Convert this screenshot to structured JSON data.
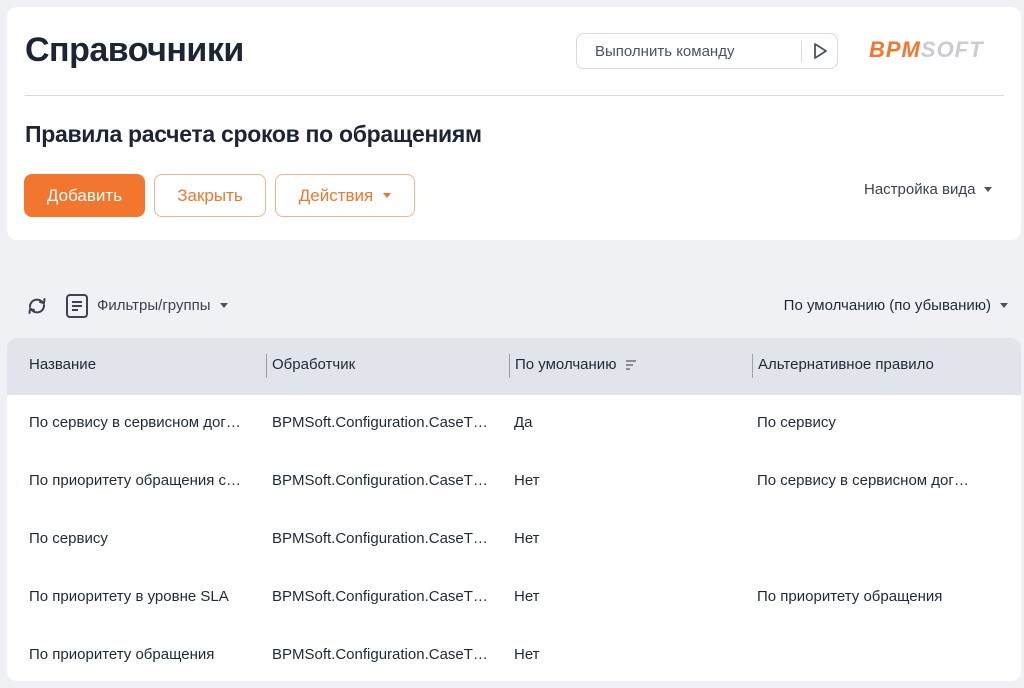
{
  "header": {
    "page_title": "Справочники",
    "command_placeholder": "Выполнить команду",
    "logo": {
      "part1": "BPM",
      "part2": "SOFT",
      "accent": "#f2762e",
      "muted": "#c9ccd2"
    }
  },
  "section": {
    "title": "Правила расчета сроков по обращениям"
  },
  "toolbar": {
    "add_label": "Добавить",
    "close_label": "Закрыть",
    "actions_label": "Действия",
    "view_settings_label": "Настройка вида"
  },
  "list_toolbar": {
    "filters_label": "Фильтры/группы",
    "sort_label": "По умолчанию (по убыванию)"
  },
  "grid": {
    "columns": [
      "Название",
      "Обработчик",
      "По умолчанию",
      "Альтернативное правило"
    ],
    "rows": [
      [
        "По сервису в сервисном дог…",
        "BPMSoft.Configuration.CaseT…",
        "Да",
        "По сервису"
      ],
      [
        "По приоритету обращения с…",
        "BPMSoft.Configuration.CaseT…",
        "Нет",
        "По сервису в сервисном дог…"
      ],
      [
        "По сервису",
        "BPMSoft.Configuration.CaseT…",
        "Нет",
        ""
      ],
      [
        "По приоритету в уровне SLA",
        "BPMSoft.Configuration.CaseT…",
        "Нет",
        "По приоритету обращения"
      ],
      [
        "По приоритету обращения",
        "BPMSoft.Configuration.CaseT…",
        "Нет",
        ""
      ]
    ]
  },
  "icons": {
    "run": "play-outline-icon",
    "refresh": "refresh-icon",
    "filter": "filter-list-icon",
    "sort": "sort-icon"
  },
  "colors": {
    "accent": "#f2762e",
    "background": "#f0f1f4",
    "grid_header": "#e1e4ea"
  }
}
